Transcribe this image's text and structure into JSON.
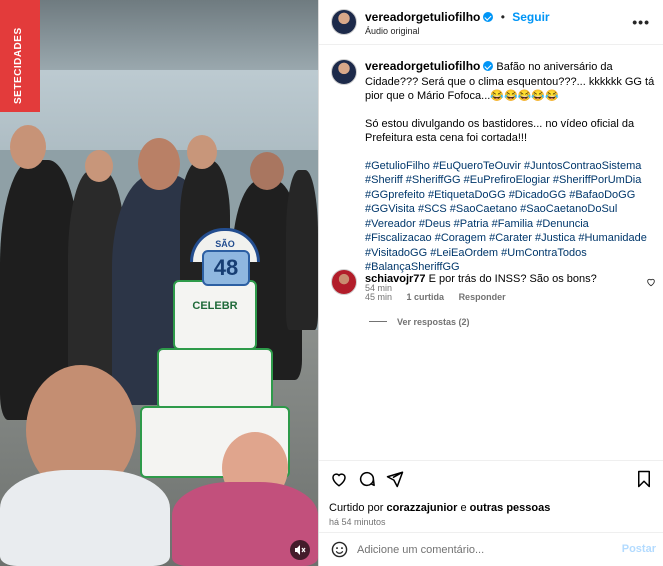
{
  "media": {
    "vertical_tag": "SETECIDADES",
    "cake_topper": "SÃO CAETANO",
    "cake_number": "48",
    "cake_text": "CELEBR"
  },
  "header": {
    "username": "vereadorgetuliofilho",
    "follow_label": "Seguir",
    "audio_label": "Áudio original",
    "more_icon": "more-horizontal-icon"
  },
  "caption": {
    "username": "vereadorgetuliofilho",
    "line1": "Bafão no aniversário da Cidade??? Será que o clima esquentou???... kkkkkk GG tá pior que o Mário Fofoca...😂😂😂😂😂",
    "line2": "Só estou divulgando os bastidores... no vídeo oficial da Prefeitura esta cena foi cortada!!!",
    "hashtags": "#GetulioFilho #EuQueroTeOuvir #JuntosContraoSistema #Sheriff #SheriffGG #EuPrefiroElogiar #SheriffPorUmDia #GGprefeito #EtiquetaDoGG #DicadoGG #BafaoDoGG #GGVisita #SCS #SaoCaetano #SaoCaetanoDoSul #Vereador #Deus #Patria #Familia #Denuncia #Fiscalizacao #Coragem #Carater #Justica #Humanidade #VisitadoGG #LeiEaOrdem #UmContraTodos #BalançaSheriffGG",
    "time": "54 min"
  },
  "comment": {
    "username": "schiavojr77",
    "text": "E por trás do INSS? São os bons?",
    "time": "45 min",
    "likes": "1 curtida",
    "reply_label": "Responder",
    "view_replies": "Ver respostas (2)"
  },
  "actions": {
    "liked_prefix": "Curtido por",
    "liked_user": "corazzajunior",
    "liked_suffix": "e",
    "liked_others": "outras pessoas",
    "time_ago": "há 54 minutos"
  },
  "add_comment": {
    "placeholder": "Adicione um comentário...",
    "post_label": "Postar"
  },
  "colors": {
    "link_blue": "#0095f6",
    "hashtag_blue": "#00376b",
    "muted_gray": "#737373",
    "tag_red": "#e33b3b"
  }
}
